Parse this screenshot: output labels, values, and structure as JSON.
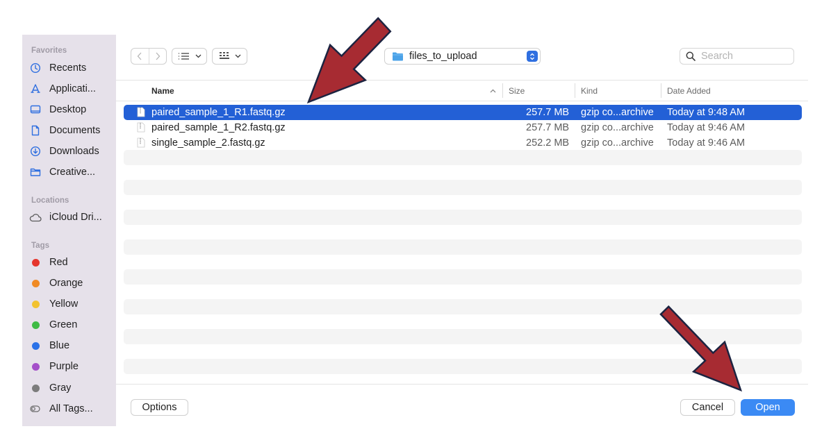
{
  "sidebar": {
    "favorites_heading": "Favorites",
    "favorites": [
      {
        "label": "Recents",
        "icon": "clock-icon"
      },
      {
        "label": "Applicati...",
        "icon": "applications-icon"
      },
      {
        "label": "Desktop",
        "icon": "desktop-icon"
      },
      {
        "label": "Documents",
        "icon": "document-icon"
      },
      {
        "label": "Downloads",
        "icon": "download-icon"
      },
      {
        "label": "Creative...",
        "icon": "folder-icon"
      }
    ],
    "locations_heading": "Locations",
    "locations": [
      {
        "label": "iCloud Dri...",
        "icon": "cloud-icon"
      }
    ],
    "tags_heading": "Tags",
    "tags": [
      {
        "label": "Red",
        "color": "#e5352d"
      },
      {
        "label": "Orange",
        "color": "#f08a24"
      },
      {
        "label": "Yellow",
        "color": "#f2c230"
      },
      {
        "label": "Green",
        "color": "#3fbb45"
      },
      {
        "label": "Blue",
        "color": "#2b72e8"
      },
      {
        "label": "Purple",
        "color": "#a44fc9"
      },
      {
        "label": "Gray",
        "color": "#7c7c7c"
      },
      {
        "label": "All Tags...",
        "icon": "all-tags-icon"
      }
    ]
  },
  "toolbar": {
    "current_folder": "files_to_upload",
    "search_placeholder": "Search"
  },
  "columns": {
    "name": "Name",
    "size": "Size",
    "kind": "Kind",
    "date_added": "Date Added"
  },
  "files": [
    {
      "name": "paired_sample_1_R1.fastq.gz",
      "size": "257.7 MB",
      "kind": "gzip co...archive",
      "date_added": "Today at 9:48 AM",
      "selected": true
    },
    {
      "name": "paired_sample_1_R2.fastq.gz",
      "size": "257.7 MB",
      "kind": "gzip co...archive",
      "date_added": "Today at 9:46 AM",
      "selected": false
    },
    {
      "name": "single_sample_2.fastq.gz",
      "size": "252.2 MB",
      "kind": "gzip co...archive",
      "date_added": "Today at 9:46 AM",
      "selected": false
    }
  ],
  "footer": {
    "options_label": "Options",
    "cancel_label": "Cancel",
    "open_label": "Open"
  },
  "colors": {
    "selection": "#2360d6",
    "open_button": "#3b8af4",
    "annotation_arrow": "#a72b32",
    "arrow_outline": "#1c2340"
  }
}
